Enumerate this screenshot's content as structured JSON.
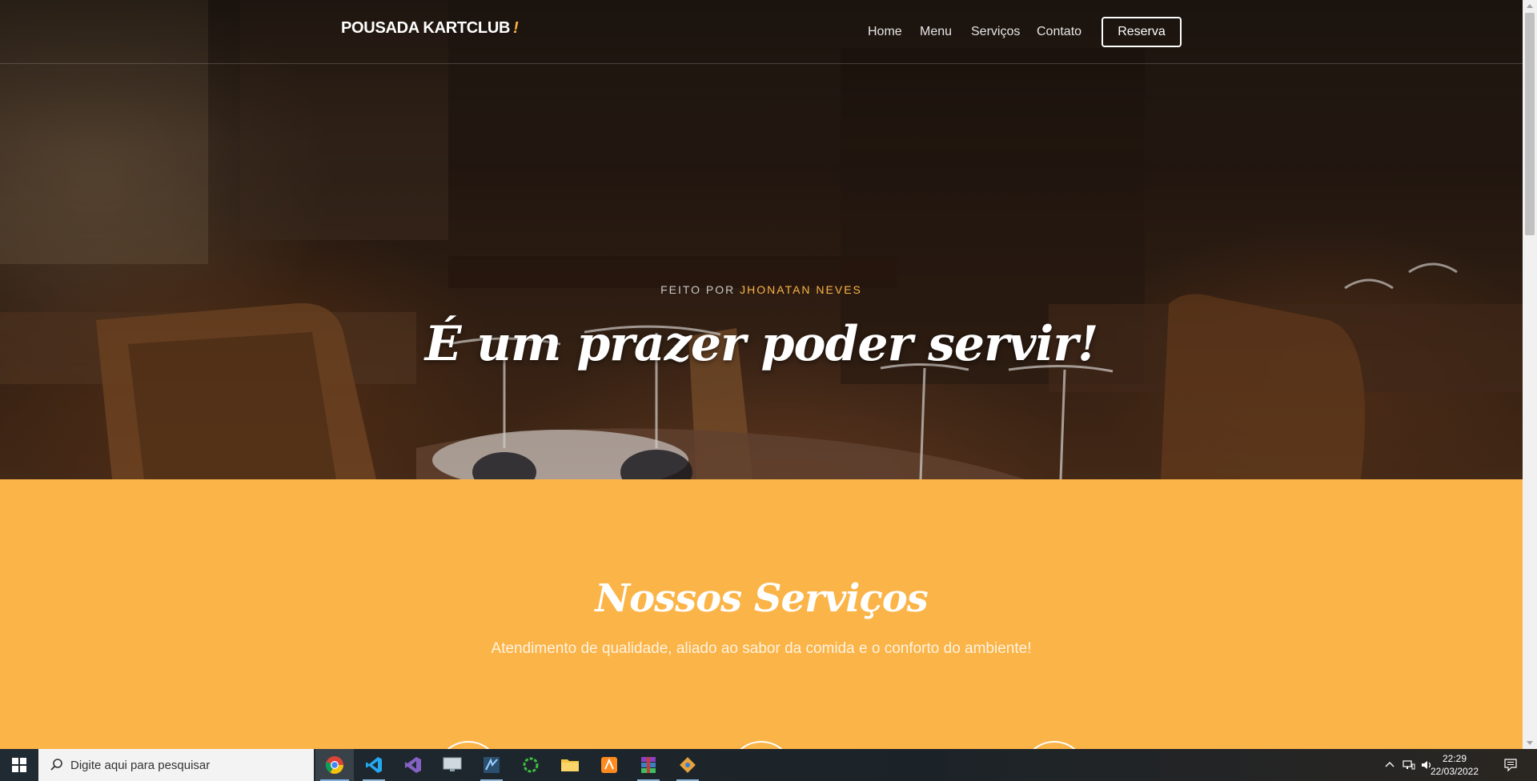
{
  "nav": {
    "brand": "POUSADA KARTCLUB",
    "brand_mark": "!",
    "links": [
      "Home",
      "Menu",
      "Serviços",
      "Contato"
    ],
    "cta": "Reserva"
  },
  "hero": {
    "kicker_prefix": "FEITO POR",
    "kicker_author": "JHONATAN NEVES",
    "title": "É um prazer poder servir!"
  },
  "services": {
    "title": "Nossos Serviços",
    "subtitle": "Atendimento de qualidade, aliado ao sabor da comida e o conforto do ambiente!"
  },
  "taskbar": {
    "search_placeholder": "Digite aqui para pesquisar",
    "time": "22:29",
    "date": "22/03/2022",
    "apps": [
      "chrome-icon",
      "vscode-icon",
      "visual-studio-icon",
      "remote-desktop-icon",
      "sql-server-icon",
      "refresh-app-icon",
      "file-explorer-icon",
      "sublime-text-icon",
      "winrar-icon",
      "git-icon"
    ]
  },
  "colors": {
    "accent": "#fbb448",
    "services_bg": "#fbb448"
  }
}
